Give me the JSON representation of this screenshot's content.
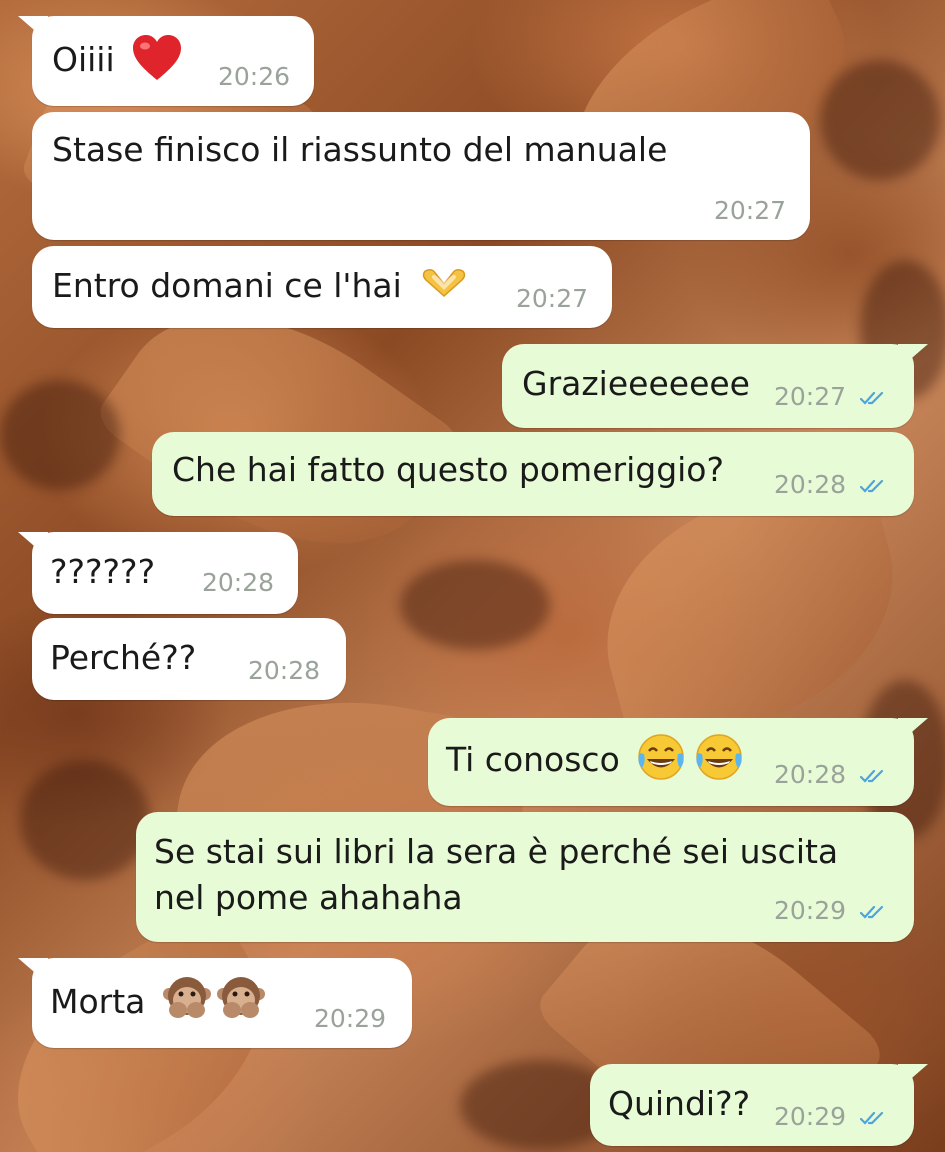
{
  "chat": {
    "messages": [
      {
        "text": "Oiiii",
        "time": "20:26",
        "emoji": "heart-emoji"
      },
      {
        "text": "Stase finisco il riassunto del manuale",
        "time": "20:27"
      },
      {
        "text": "Entro domani ce l'hai",
        "time": "20:27",
        "emoji": "heart-hands-emoji"
      },
      {
        "text": "Grazieeeeeee",
        "time": "20:27",
        "status": "read"
      },
      {
        "text": "Che hai fatto questo pomeriggio?",
        "time": "20:28",
        "status": "read"
      },
      {
        "text": "??????",
        "time": "20:28"
      },
      {
        "text": "Perché??",
        "time": "20:28"
      },
      {
        "text": "Ti conosco",
        "time": "20:28",
        "status": "read",
        "emoji": "tears-of-joy-emoji"
      },
      {
        "text_line1": "Se stai sui libri la sera è perché sei uscita",
        "text_line2": "nel pome ahahaha",
        "time": "20:29",
        "status": "read"
      },
      {
        "text": "Morta",
        "time": "20:29",
        "emoji": "speak-no-evil-monkey-emoji"
      },
      {
        "text": "Quindi??",
        "time": "20:29",
        "status": "read"
      }
    ]
  },
  "colors": {
    "incoming_bubble": "#ffffff",
    "outgoing_bubble": "#e7fcd6",
    "read_ticks": "#4fa3e0",
    "heart": "#e0242b"
  }
}
